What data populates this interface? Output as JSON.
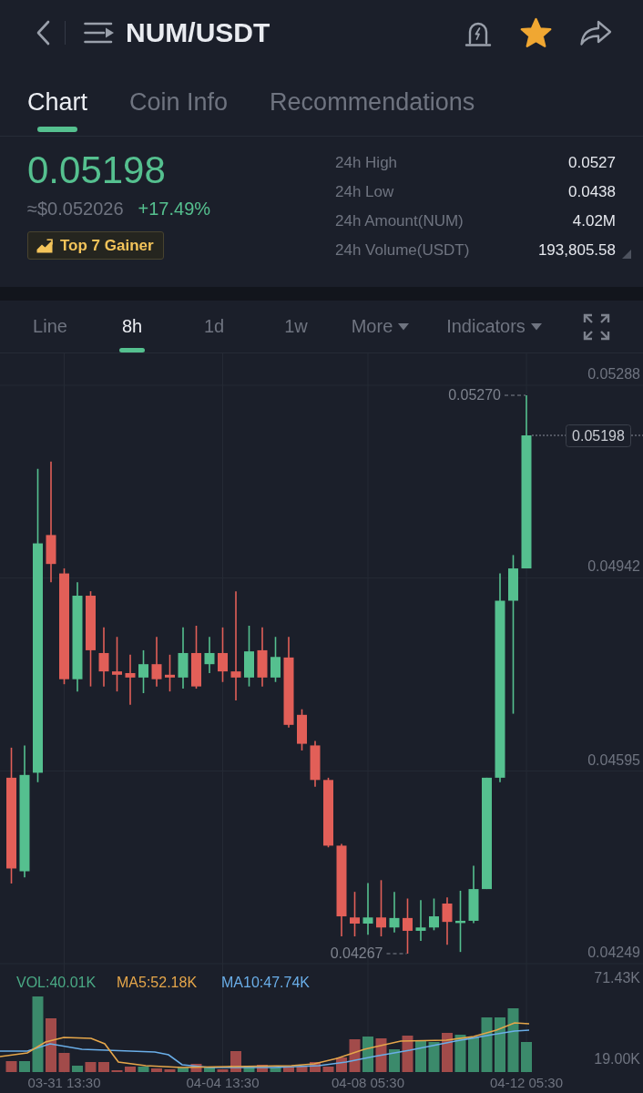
{
  "header": {
    "title": "NUM/USDT",
    "favorite": true
  },
  "tabs": [
    {
      "label": "Chart",
      "selected": true
    },
    {
      "label": "Coin Info",
      "selected": false
    },
    {
      "label": "Recommendations",
      "selected": false
    }
  ],
  "ticker": {
    "price": "0.05198",
    "usd_price": "≈$0.052026",
    "change": "+17.49%",
    "badge": "Top 7 Gainer",
    "stats": [
      {
        "label": "24h High",
        "value": "0.0527"
      },
      {
        "label": "24h Low",
        "value": "0.0438"
      },
      {
        "label": "24h Amount(NUM)",
        "value": "4.02M"
      },
      {
        "label": "24h Volume(USDT)",
        "value": "193,805.58"
      }
    ]
  },
  "intervals": [
    {
      "label": "Line",
      "kind": "tab",
      "selected": false
    },
    {
      "label": "8h",
      "kind": "tab",
      "selected": true
    },
    {
      "label": "1d",
      "kind": "tab",
      "selected": false
    },
    {
      "label": "1w",
      "kind": "tab",
      "selected": false
    },
    {
      "label": "More",
      "kind": "menu",
      "selected": false
    },
    {
      "label": "Indicators",
      "kind": "menu",
      "selected": false
    }
  ],
  "chart": {
    "chart_data": {
      "type": "candlestick",
      "grid": true,
      "categories": [
        null,
        null,
        null,
        null,
        "03-31 13:30",
        null,
        null,
        null,
        null,
        null,
        null,
        null,
        null,
        null,
        null,
        null,
        "04-04 13:30",
        null,
        null,
        null,
        null,
        null,
        null,
        null,
        null,
        null,
        null,
        "04-08 05:30",
        null,
        null,
        null,
        null,
        null,
        null,
        null,
        null,
        null,
        null,
        null,
        "04-12 05:30"
      ],
      "ohlc": [
        [
          0.04583,
          0.04637,
          0.04393,
          0.0442
        ],
        [
          0.04415,
          0.04641,
          0.04404,
          0.04588
        ],
        [
          0.04592,
          0.05138,
          0.04575,
          0.05004
        ],
        [
          0.05019,
          0.05151,
          0.04934,
          0.04967
        ],
        [
          0.0495,
          0.04959,
          0.04751,
          0.0476
        ],
        [
          0.0476,
          0.04934,
          0.04738,
          0.0491
        ],
        [
          0.0491,
          0.04918,
          0.04747,
          0.04812
        ],
        [
          0.04807,
          0.04853,
          0.04747,
          0.04774
        ],
        [
          0.04774,
          0.04836,
          0.04738,
          0.04768
        ],
        [
          0.04771,
          0.04804,
          0.04714,
          0.04763
        ],
        [
          0.04763,
          0.04812,
          0.04735,
          0.04787
        ],
        [
          0.04787,
          0.04836,
          0.04747,
          0.0476
        ],
        [
          0.04768,
          0.04804,
          0.04738,
          0.04763
        ],
        [
          0.04763,
          0.04853,
          0.04743,
          0.04807
        ],
        [
          0.04807,
          0.04856,
          0.04743,
          0.04747
        ],
        [
          0.04787,
          0.04836,
          0.04771,
          0.04807
        ],
        [
          0.04807,
          0.04853,
          0.04755,
          0.04774
        ],
        [
          0.04774,
          0.04918,
          0.04722,
          0.04763
        ],
        [
          0.04763,
          0.04856,
          0.04747,
          0.0481
        ],
        [
          0.04812,
          0.04853,
          0.04747,
          0.04763
        ],
        [
          0.04763,
          0.04836,
          0.04755,
          0.048
        ],
        [
          0.04799,
          0.04836,
          0.04673,
          0.04678
        ],
        [
          0.04696,
          0.04706,
          0.04632,
          0.04644
        ],
        [
          0.04641,
          0.04649,
          0.04567,
          0.04579
        ],
        [
          0.04579,
          0.04583,
          0.04458,
          0.04461
        ],
        [
          0.04461,
          0.04464,
          0.04298,
          0.04334
        ],
        [
          0.04332,
          0.04378,
          0.04298,
          0.04321
        ],
        [
          0.04321,
          0.04394,
          0.04301,
          0.04332
        ],
        [
          0.04332,
          0.04399,
          0.04298,
          0.04314
        ],
        [
          0.04314,
          0.04378,
          0.04305,
          0.04331
        ],
        [
          0.04331,
          0.04366,
          0.04267,
          0.04308
        ],
        [
          0.04308,
          0.04363,
          0.0429,
          0.04314
        ],
        [
          0.04314,
          0.04366,
          0.04309,
          0.04334
        ],
        [
          0.04357,
          0.04368,
          0.04283,
          0.04324
        ],
        [
          0.04322,
          0.0438,
          0.0427,
          0.04326
        ],
        [
          0.04326,
          0.04425,
          0.04322,
          0.04383
        ],
        [
          0.04383,
          0.04583,
          0.04383,
          0.04583
        ],
        [
          0.04583,
          0.0495,
          0.04575,
          0.04901
        ],
        [
          0.04901,
          0.04983,
          0.04698,
          0.04959
        ],
        [
          0.04959,
          0.0527,
          0.04959,
          0.05198
        ]
      ],
      "ylim": [
        0.04249,
        0.05288
      ],
      "yticks": [
        {
          "value": 0.05288,
          "label": "0.05288"
        },
        {
          "value": 0.04942,
          "label": "0.04942"
        },
        {
          "value": 0.04595,
          "label": "0.04595"
        },
        {
          "value": 0.04249,
          "label": "0.04249"
        }
      ]
    },
    "high_marker": "0.05270",
    "low_marker": "0.04267",
    "last_price": "0.05198"
  },
  "volume": {
    "legend": [
      {
        "label": "VOL:40.01K",
        "color": "#4aaa85"
      },
      {
        "label": "MA5:52.18K",
        "color": "#e5a64a"
      },
      {
        "label": "MA10:47.74K",
        "color": "#6aaee8"
      }
    ],
    "ticks": [
      "71.43K",
      "19.00K"
    ]
  }
}
